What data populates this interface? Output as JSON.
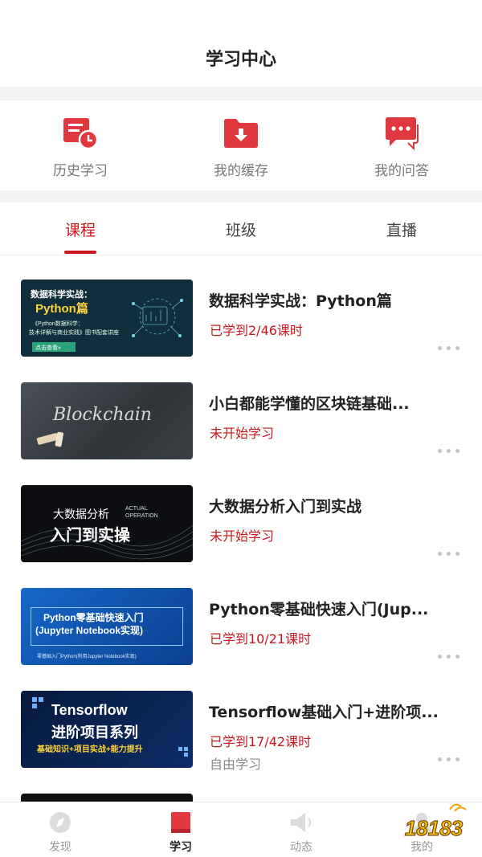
{
  "header": {
    "title": "学习中心"
  },
  "quick_actions": [
    {
      "label": "历史学习",
      "icon": "history-icon"
    },
    {
      "label": "我的缓存",
      "icon": "download-folder-icon"
    },
    {
      "label": "我的问答",
      "icon": "chat-bubble-icon"
    }
  ],
  "tabs": [
    {
      "label": "课程",
      "active": true
    },
    {
      "label": "班级",
      "active": false
    },
    {
      "label": "直播",
      "active": false
    }
  ],
  "courses": [
    {
      "title": "数据科学实战：Python篇",
      "progress": "已学到2/46课时",
      "subtitle": "",
      "thumb": {
        "line1": "数据科学实战：",
        "line2": "Python篇",
        "line3": "《Python数据科学：",
        "line4": "技术详解与商业实践》图书配套讲座",
        "button": "点击查看»"
      }
    },
    {
      "title": "小白都能学懂的区块链基础...",
      "progress": "未开始学习",
      "subtitle": "",
      "thumb": {
        "line1": "Blockchain"
      }
    },
    {
      "title": "大数据分析入门到实战",
      "progress": "未开始学习",
      "subtitle": "",
      "thumb": {
        "line1": "大数据分析",
        "line2": "入门到实操",
        "line3": "ACTUAL",
        "line4": "OPERATION"
      }
    },
    {
      "title": "Python零基础快速入门(Jup...",
      "progress": "已学到10/21课时",
      "subtitle": "",
      "thumb": {
        "line1": "Python零基础快速入门",
        "line2": "(Jupyter Notebook实现)",
        "line3": "零基础入门Python(利用Jupyter Notebook实现)"
      }
    },
    {
      "title": "Tensorflow基础入门+进阶项...",
      "progress": "已学到17/42课时",
      "subtitle": "自由学习",
      "thumb": {
        "line1": "Tensorflow",
        "line2": "进阶项目系列",
        "line3": "基础知识+项目实战+能力提升"
      }
    }
  ],
  "bottom_nav": [
    {
      "label": "发现",
      "icon": "compass-icon",
      "active": false
    },
    {
      "label": "学习",
      "icon": "book-icon",
      "active": true
    },
    {
      "label": "动态",
      "icon": "megaphone-icon",
      "active": false
    },
    {
      "label": "我的",
      "icon": "profile-icon",
      "active": false
    }
  ],
  "watermark": {
    "text": "18183"
  },
  "colors": {
    "accent": "#c8161d",
    "icon_red": "#e0383f",
    "muted": "#888888"
  }
}
